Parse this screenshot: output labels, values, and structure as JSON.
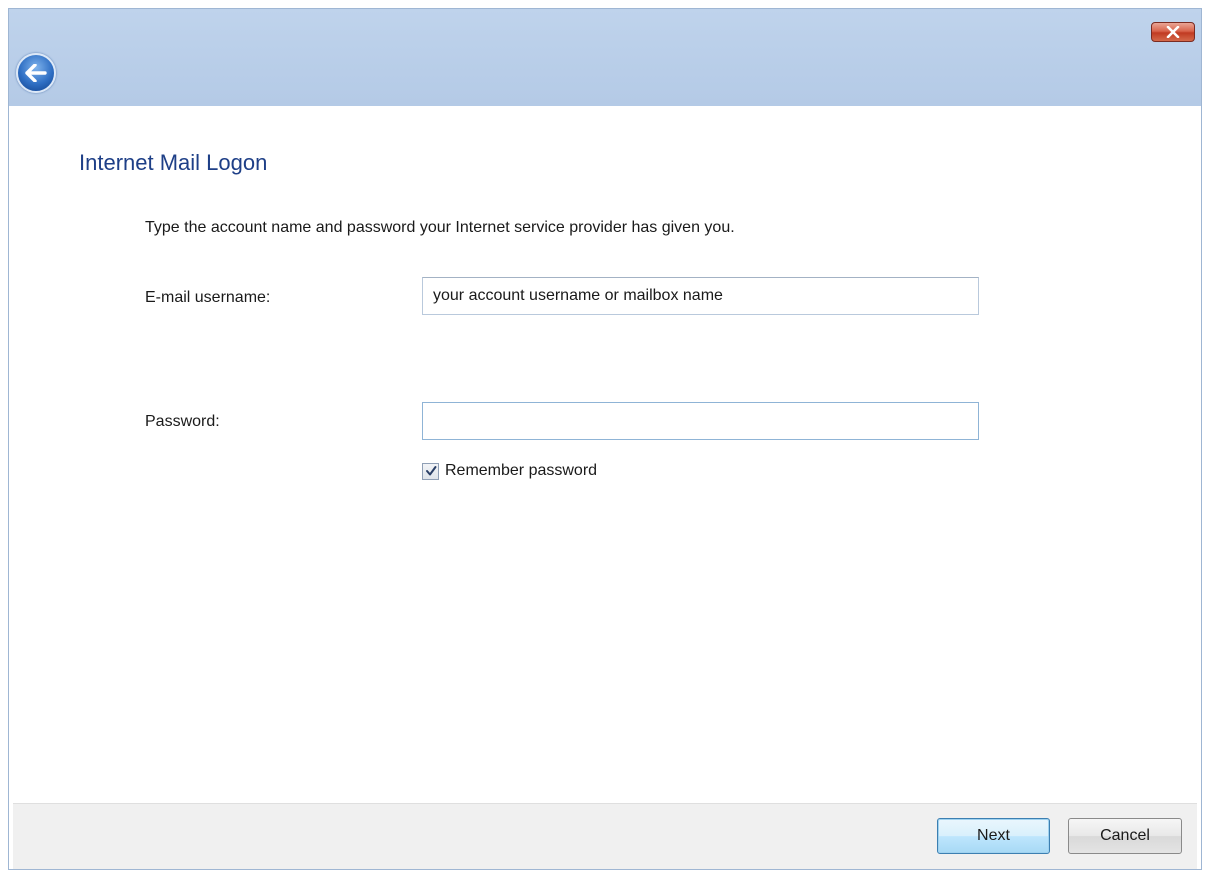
{
  "window": {
    "close_icon": "close-icon",
    "back_icon": "back-arrow-icon"
  },
  "dialog": {
    "title": "Internet Mail Logon",
    "instructions": "Type the account name and password your Internet service provider has given you."
  },
  "form": {
    "username": {
      "label": "E-mail username:",
      "value": "your account username or mailbox name"
    },
    "password": {
      "label": "Password:",
      "value": ""
    },
    "remember_password": {
      "label": "Remember password",
      "checked": true
    }
  },
  "footer": {
    "next_label": "Next",
    "cancel_label": "Cancel"
  },
  "colors": {
    "title_text": "#1e3f87",
    "titlebar": "#bfd3ec",
    "close_button": "#c13b22"
  }
}
